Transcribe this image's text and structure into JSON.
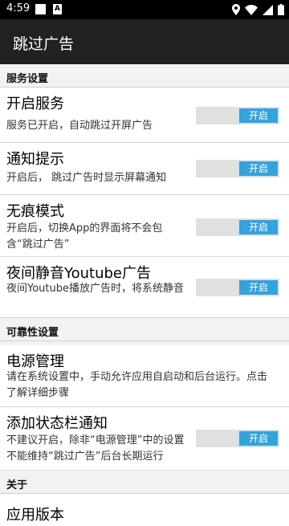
{
  "status_bar": {
    "time": "4:59",
    "notif_icon_letter": "A",
    "icons": [
      "location-icon",
      "wifi-icon",
      "signal-icon",
      "battery-icon"
    ]
  },
  "app_bar": {
    "title": "跳过广告"
  },
  "sections": {
    "service": {
      "label": "服务设置"
    },
    "reliability": {
      "label": "可靠性设置"
    },
    "about": {
      "label": "关于"
    }
  },
  "prefs": {
    "enable_service": {
      "title": "开启服务",
      "summary": "服务已开启，自动跳过开屏广告",
      "toggle_label": "开启",
      "checked": true
    },
    "notify": {
      "title": "通知提示",
      "summary": "开启后， 跳过广告时显示屏幕通知",
      "toggle_label": "开启",
      "checked": true
    },
    "traceless": {
      "title": "无痕模式",
      "summary": "开启后，切换App的界面将不会包含“跳过广告”",
      "toggle_label": "开启",
      "checked": true
    },
    "youtube_mute": {
      "title": "夜间静音Youtube广告",
      "summary": "夜间Youtube播放广告时，将系统静音",
      "toggle_label": "开启",
      "checked": true
    },
    "power": {
      "title": "电源管理",
      "summary": "请在系统设置中，手动允许应用自启动和后台运行。点击了解详细步骤"
    },
    "statusbar_notif": {
      "title": "添加状态栏通知",
      "summary": "不建议开启，除非“电源管理”中的设置不能维持“跳过广告”后台长期运行",
      "toggle_label": "开启",
      "checked": true
    },
    "version": {
      "title": "应用版本"
    }
  },
  "colors": {
    "accent": "#33a3dc",
    "app_bar": "#212121",
    "background": "#f2f2f2"
  }
}
